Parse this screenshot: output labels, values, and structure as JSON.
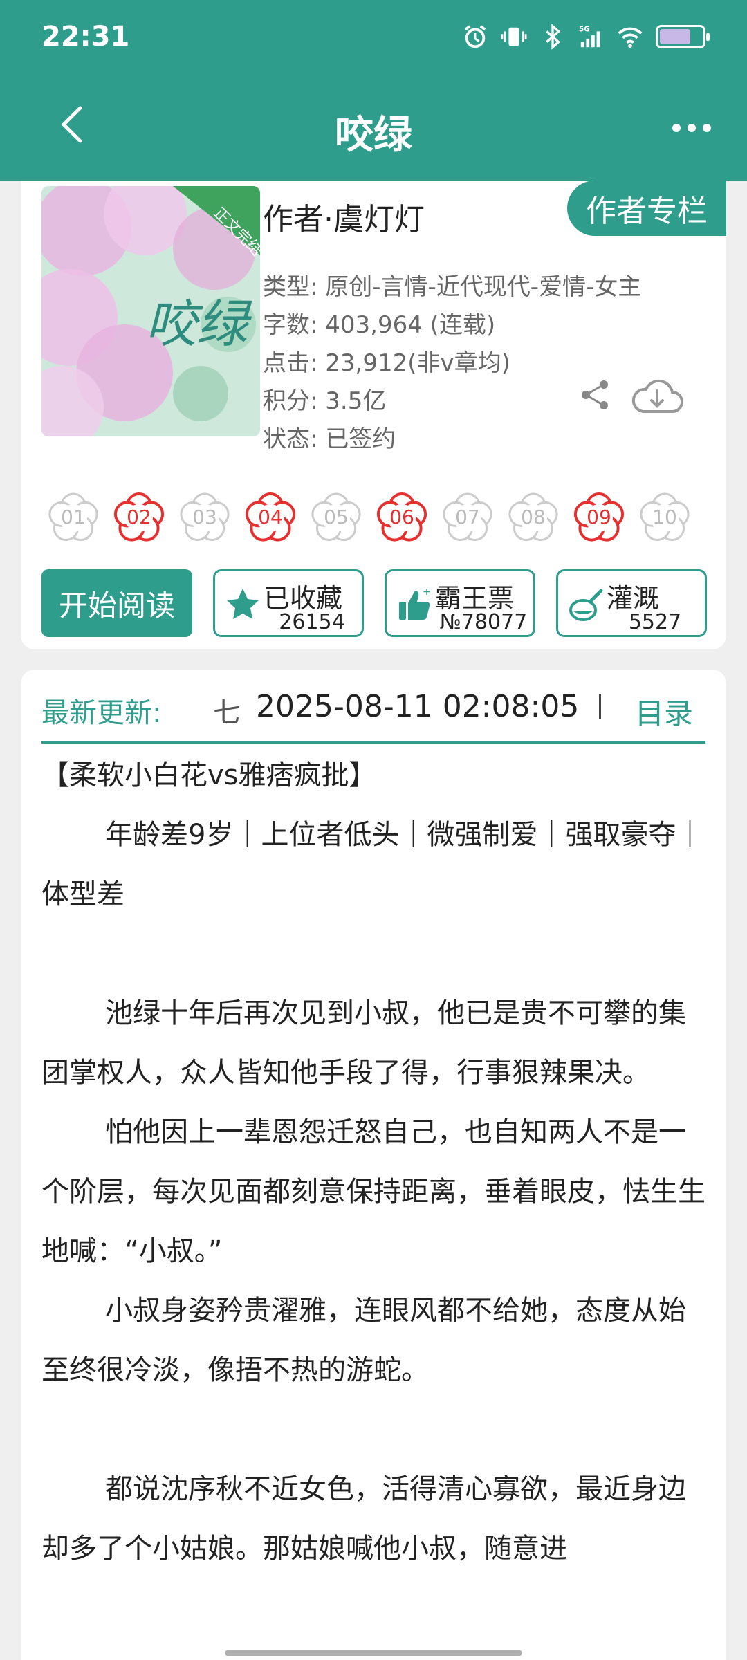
{
  "status_bar": {
    "time": "22:31"
  },
  "header": {
    "title": "咬绿"
  },
  "book": {
    "cover_title": "咬绿",
    "cover_ribbon": "正文完结",
    "author_tab": "作者专栏",
    "author": "作者·虞灯灯",
    "type": "类型: 原创-言情-近代现代-爱情-女主",
    "words": "字数: 403,964 (连载)",
    "clicks": "点击: 23,912(非v章均)",
    "score": "积分: 3.5亿",
    "status": "状态: 已签约"
  },
  "flowers": [
    {
      "n": "01",
      "active": false
    },
    {
      "n": "02",
      "active": true
    },
    {
      "n": "03",
      "active": false
    },
    {
      "n": "04",
      "active": true
    },
    {
      "n": "05",
      "active": false
    },
    {
      "n": "06",
      "active": true
    },
    {
      "n": "07",
      "active": false
    },
    {
      "n": "08",
      "active": false
    },
    {
      "n": "09",
      "active": true
    },
    {
      "n": "10",
      "active": false
    }
  ],
  "actions": {
    "read": "开始阅读",
    "favorite": {
      "label": "已收藏",
      "count": "26154"
    },
    "ticket": {
      "label": "霸王票",
      "count": "№78077"
    },
    "nutrient": {
      "label": "灌溉",
      "count": "5527"
    }
  },
  "latest": {
    "label": "最新更新:",
    "chapter": "七",
    "time": "2025-08-11 02:08:05",
    "toc": "目录"
  },
  "intro": [
    {
      "text": "【柔软小白花vs雅痞疯批】",
      "indent": false
    },
    {
      "text": "年龄差9岁｜上位者低头｜微强制爱｜强取豪夺｜体型差",
      "indent": true
    },
    {
      "text": "",
      "indent": false
    },
    {
      "text": "池绿十年后再次见到小叔，他已是贵不可攀的集团掌权人，众人皆知他手段了得，行事狠辣果决。",
      "indent": true
    },
    {
      "text": "怕他因上一辈恩怨迁怒自己，也自知两人不是一个阶层，每次见面都刻意保持距离，垂着眼皮，怯生生地喊：“小叔。”",
      "indent": true
    },
    {
      "text": "小叔身姿矜贵濯雅，连眼风都不给她，态度从始至终很冷淡，像捂不热的游蛇。",
      "indent": true
    },
    {
      "text": "",
      "indent": false
    },
    {
      "text": "都说沈序秋不近女色，活得清心寡欲，最近身边却多了个小姑娘。那姑娘喊他小叔，随意进",
      "indent": true
    }
  ]
}
